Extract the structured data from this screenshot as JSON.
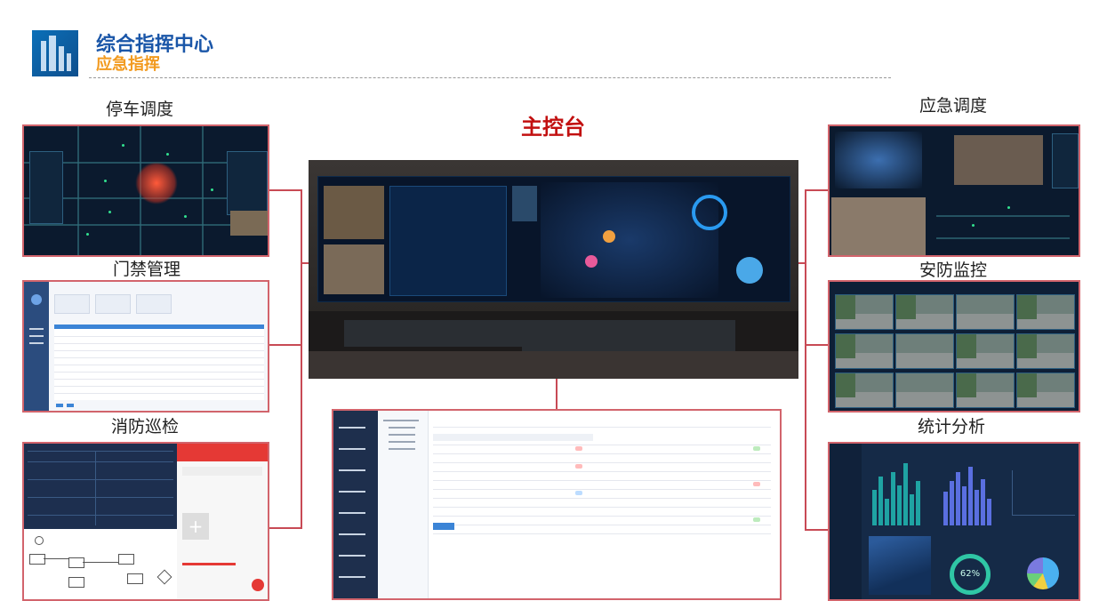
{
  "header": {
    "title": "综合指挥中心",
    "subtitle": "应急指挥"
  },
  "main": {
    "title": "主控台"
  },
  "left_panels": [
    {
      "label": "停车调度"
    },
    {
      "label": "门禁管理"
    },
    {
      "label": "消防巡检"
    }
  ],
  "right_panels": [
    {
      "label": "应急调度"
    },
    {
      "label": "安防监控"
    },
    {
      "label": "统计分析"
    }
  ],
  "stats_panel": {
    "donut_value": "62%"
  },
  "colors": {
    "brand_blue": "#1a56a8",
    "accent_orange": "#f29a1f",
    "title_red": "#c21010",
    "frame_red": "#d2646c"
  }
}
